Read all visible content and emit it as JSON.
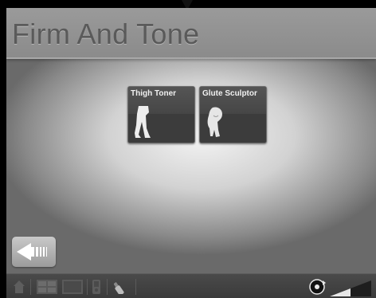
{
  "page": {
    "title": "Firm And Tone"
  },
  "workouts": [
    {
      "label": "Thigh Toner",
      "icon": "legs-figure-icon"
    },
    {
      "label": "Glute Sculptor",
      "icon": "glute-figure-icon"
    }
  ],
  "navigation": {
    "back_icon": "back-arrow-icon"
  },
  "toolbar": {
    "icons": [
      "home-icon",
      "grid-view-icon",
      "screen-icon",
      "device-icon",
      "bottle-icon",
      "media-icon",
      "volume-icon"
    ]
  },
  "colors": {
    "tile_bg": "#3c3c3c",
    "header_bg": "#8e8e8e",
    "toolbar_bg": "#3f3f3f"
  }
}
